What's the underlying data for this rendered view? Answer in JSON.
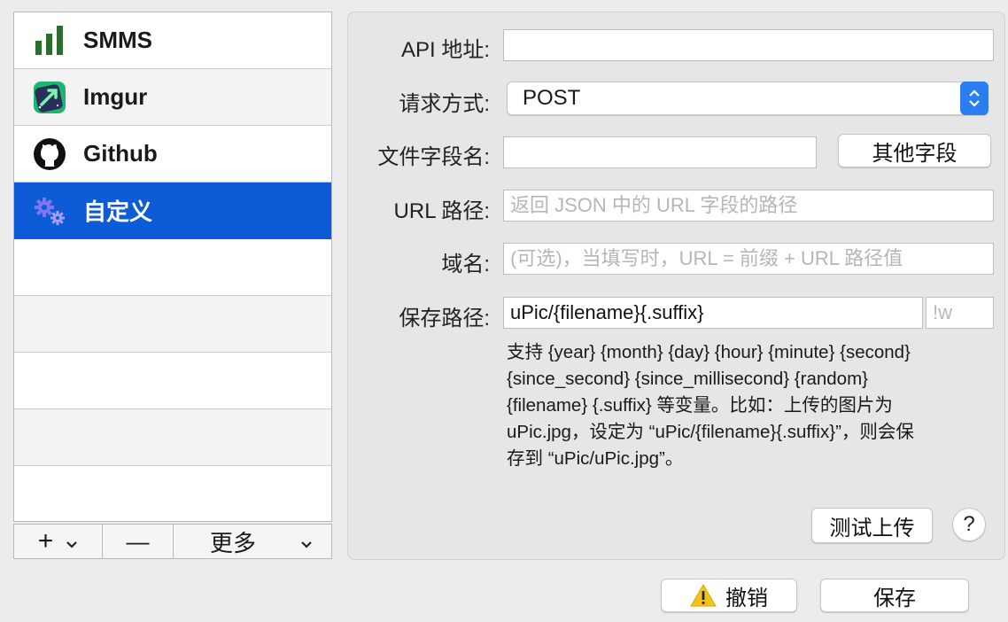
{
  "sidebar": {
    "items": [
      {
        "label": "SMMS",
        "icon": "smms-bars-icon"
      },
      {
        "label": "Imgur",
        "icon": "imgur-icon"
      },
      {
        "label": "Github",
        "icon": "github-icon"
      },
      {
        "label": "自定义",
        "icon": "gears-icon",
        "selected": true
      }
    ],
    "bottom": {
      "add": "+",
      "remove": "—",
      "more": "更多"
    }
  },
  "form": {
    "api_label": "API 地址:",
    "api_value": "",
    "method_label": "请求方式:",
    "method_value": "POST",
    "field_label": "文件字段名:",
    "field_value": "",
    "other_fields_button": "其他字段",
    "url_label": "URL 路径:",
    "url_placeholder": "返回 JSON 中的 URL 字段的路径",
    "domain_label": "域名:",
    "domain_placeholder": "(可选)，当填写时，URL = 前缀 + URL 路径值",
    "save_path_label": "保存路径:",
    "save_path_value": "uPic/{filename}{.suffix}",
    "save_suffix_placeholder": "!w",
    "help_lines": [
      "支持 {year} {month} {day} {hour} {minute} {second}",
      "{since_second} {since_millisecond} {random}",
      "{filename} {.suffix} 等变量。比如：上传的图片为",
      "uPic.jpg，设定为 “uPic/{filename}{.suffix}”，则会保",
      "存到 “uPic/uPic.jpg”。"
    ],
    "test_button": "测试上传",
    "help_button": "?"
  },
  "footer": {
    "cancel_button": "撤销",
    "save_button": "保存"
  },
  "colors": {
    "selection": "#0d5bd6",
    "popup_arrow": "#2a7ef2",
    "warning": "#f5c318"
  }
}
